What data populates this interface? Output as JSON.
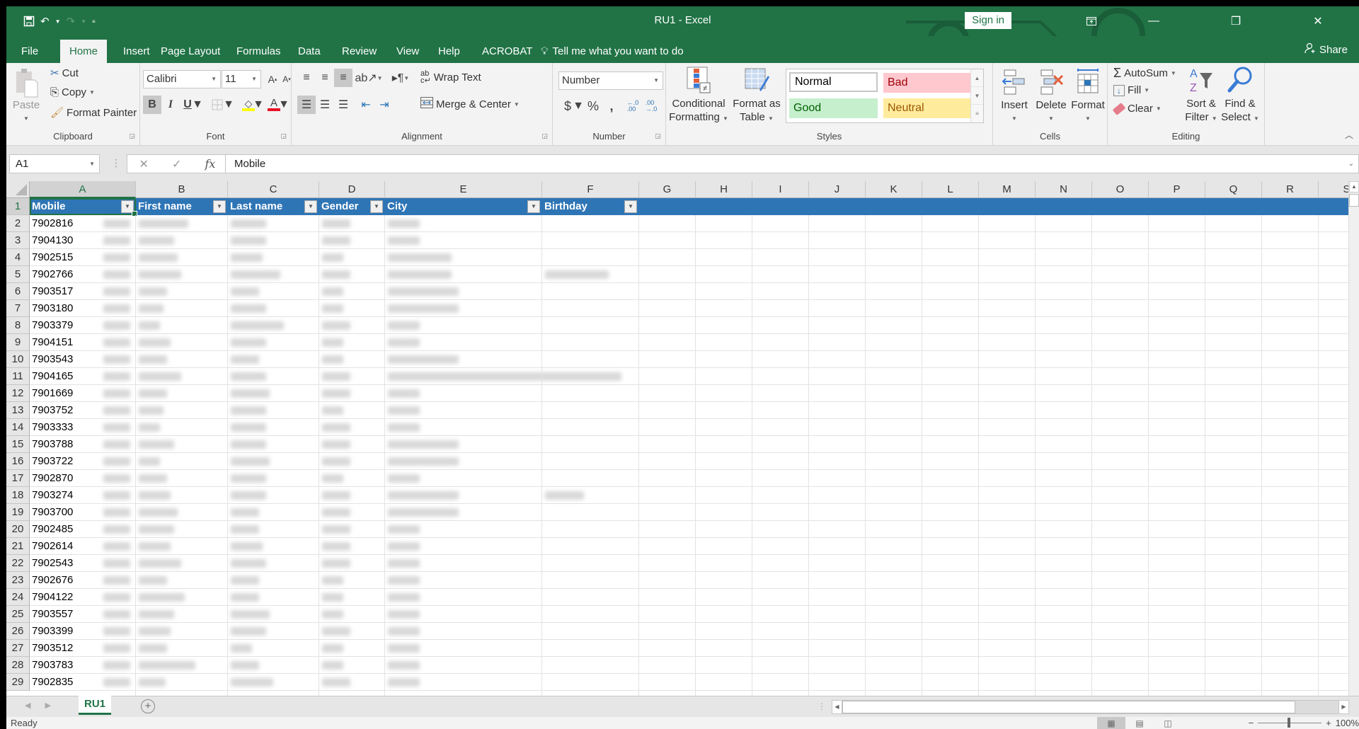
{
  "window": {
    "title": "RU1  -  Excel",
    "sign_in": "Sign in",
    "controls": [
      "ribbon-display",
      "minimize",
      "restore",
      "close"
    ]
  },
  "qat": {
    "save_icon": "save-icon",
    "undo_icon": "undo-icon",
    "redo_icon": "redo-icon",
    "customize_icon": "customize-qat-icon"
  },
  "tabs": [
    {
      "label": "File"
    },
    {
      "label": "Home",
      "active": true
    },
    {
      "label": "Insert"
    },
    {
      "label": "Page Layout"
    },
    {
      "label": "Formulas"
    },
    {
      "label": "Data"
    },
    {
      "label": "Review"
    },
    {
      "label": "View"
    },
    {
      "label": "Help"
    },
    {
      "label": "ACROBAT"
    }
  ],
  "tell_me": "Tell me what you want to do",
  "share": "Share",
  "ribbon": {
    "clipboard": {
      "label": "Clipboard",
      "paste": "Paste",
      "cut": "Cut",
      "copy": "Copy",
      "format_painter": "Format Painter"
    },
    "font": {
      "label": "Font",
      "font_name": "Calibri",
      "font_size": "11",
      "bold": "B",
      "italic": "I",
      "underline": "U",
      "font_color_hex": "#e81123",
      "fill_color_hex": "#ffff00"
    },
    "alignment": {
      "label": "Alignment",
      "wrap_text": "Wrap Text",
      "merge_center": "Merge & Center"
    },
    "number": {
      "label": "Number",
      "format": "Number",
      "currency": "$",
      "percent": "%",
      "comma": ","
    },
    "styles": {
      "label": "Styles",
      "conditional_formatting": [
        "Conditional",
        "Formatting"
      ],
      "format_as_table": [
        "Format as",
        "Table"
      ],
      "cells": [
        {
          "label": "Normal",
          "bg": "#ffffff",
          "fg": "#000000"
        },
        {
          "label": "Bad",
          "bg": "#ffc7ce",
          "fg": "#9c0006"
        },
        {
          "label": "Good",
          "bg": "#c6efce",
          "fg": "#006100"
        },
        {
          "label": "Neutral",
          "bg": "#ffeb9c",
          "fg": "#9c5700"
        }
      ]
    },
    "cells": {
      "label": "Cells",
      "insert": "Insert",
      "delete": "Delete",
      "format": "Format"
    },
    "editing": {
      "label": "Editing",
      "autosum": "AutoSum",
      "fill": "Fill",
      "clear": "Clear",
      "sort_filter": [
        "Sort &",
        "Filter"
      ],
      "find_select": [
        "Find &",
        "Select"
      ]
    }
  },
  "formula_bar": {
    "name_box": "A1",
    "content": "Mobile",
    "fx": "fx"
  },
  "sheet": {
    "columns": [
      "A",
      "B",
      "C",
      "D",
      "E",
      "F",
      "G",
      "H",
      "I",
      "J",
      "K",
      "L",
      "M",
      "N",
      "O",
      "P",
      "Q",
      "R",
      "S"
    ],
    "selected_cell": "A1",
    "header_fill": "#2e75b6",
    "headers": [
      "Mobile",
      "First name",
      "Last name",
      "Gender",
      "City",
      "Birthday"
    ],
    "rows": [
      {
        "n": "2",
        "mobile": "7902816"
      },
      {
        "n": "3",
        "mobile": "7904130"
      },
      {
        "n": "4",
        "mobile": "7902515"
      },
      {
        "n": "5",
        "mobile": "7902766"
      },
      {
        "n": "6",
        "mobile": "7903517"
      },
      {
        "n": "7",
        "mobile": "7903180"
      },
      {
        "n": "8",
        "mobile": "7903379"
      },
      {
        "n": "9",
        "mobile": "7904151"
      },
      {
        "n": "10",
        "mobile": "7903543"
      },
      {
        "n": "11",
        "mobile": "7904165"
      },
      {
        "n": "12",
        "mobile": "7901669"
      },
      {
        "n": "13",
        "mobile": "7903752"
      },
      {
        "n": "14",
        "mobile": "7903333"
      },
      {
        "n": "15",
        "mobile": "7903788"
      },
      {
        "n": "16",
        "mobile": "7903722"
      },
      {
        "n": "17",
        "mobile": "7902870"
      },
      {
        "n": "18",
        "mobile": "7903274"
      },
      {
        "n": "19",
        "mobile": "7903700"
      },
      {
        "n": "20",
        "mobile": "7902485"
      },
      {
        "n": "21",
        "mobile": "7902614"
      },
      {
        "n": "22",
        "mobile": "7902543"
      },
      {
        "n": "23",
        "mobile": "7902676"
      },
      {
        "n": "24",
        "mobile": "7904122"
      },
      {
        "n": "25",
        "mobile": "7903557"
      },
      {
        "n": "26",
        "mobile": "7903399"
      },
      {
        "n": "27",
        "mobile": "7903512"
      },
      {
        "n": "28",
        "mobile": "7903783"
      },
      {
        "n": "29",
        "mobile": "7902835"
      }
    ],
    "redacted_note": "Remaining cell contents are blurred in the screenshot"
  },
  "sheet_tabs": [
    {
      "label": "RU1",
      "active": true
    }
  ],
  "status": {
    "mode": "Ready",
    "zoom": "100%"
  }
}
